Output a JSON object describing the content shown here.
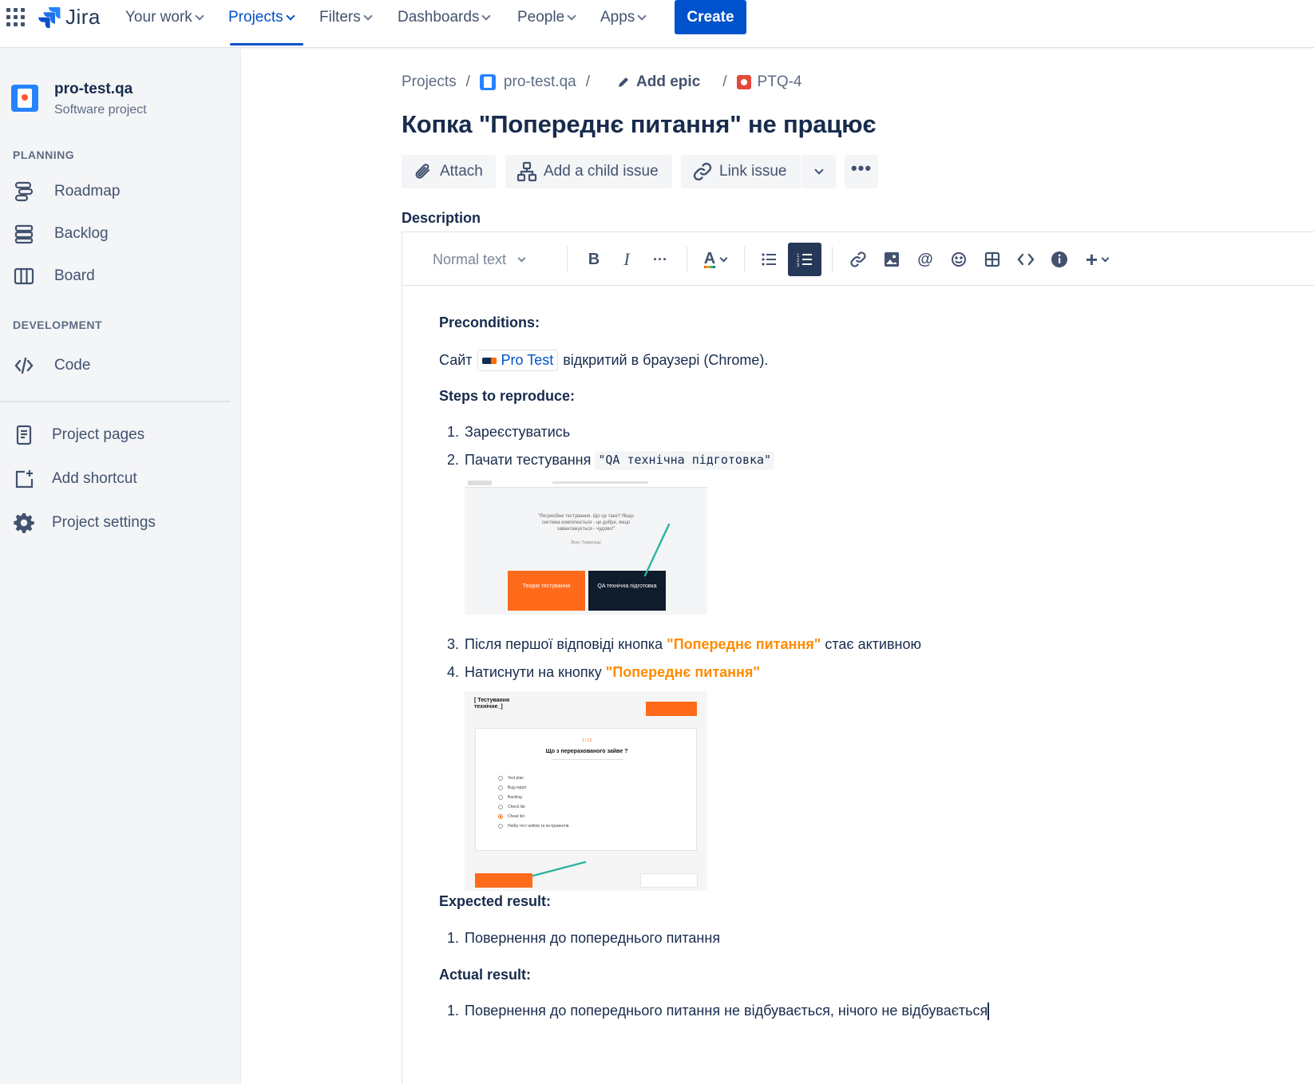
{
  "topnav": {
    "logo_text": "Jira",
    "items": [
      {
        "label": "Your work"
      },
      {
        "label": "Projects"
      },
      {
        "label": "Filters"
      },
      {
        "label": "Dashboards"
      },
      {
        "label": "People"
      },
      {
        "label": "Apps"
      }
    ],
    "create_label": "Create"
  },
  "sidebar": {
    "project_name": "pro-test.qa",
    "project_type": "Software project",
    "planning_heading": "PLANNING",
    "planning_items": [
      {
        "label": "Roadmap",
        "icon": "roadmap-icon"
      },
      {
        "label": "Backlog",
        "icon": "backlog-icon"
      },
      {
        "label": "Board",
        "icon": "board-icon"
      }
    ],
    "development_heading": "DEVELOPMENT",
    "development_items": [
      {
        "label": "Code",
        "icon": "code-icon"
      }
    ],
    "bottom_items": [
      {
        "label": "Project pages",
        "icon": "page-icon"
      },
      {
        "label": "Add shortcut",
        "icon": "add-shortcut-icon"
      },
      {
        "label": "Project settings",
        "icon": "gear-icon"
      }
    ]
  },
  "breadcrumb": {
    "projects": "Projects",
    "project": "pro-test.qa",
    "epic": "Add epic",
    "issue_key": "PTQ-4"
  },
  "issue": {
    "title": "Копка \"Попереднє питання\" не працює"
  },
  "actions": {
    "attach": "Attach",
    "add_child": "Add a child issue",
    "link_issue": "Link issue"
  },
  "description": {
    "label": "Description",
    "toolbar": {
      "text_style": "Normal text"
    },
    "preconditions_heading": "Preconditions:",
    "preconditions_prefix": "Сайт",
    "preconditions_link": "Pro Test",
    "preconditions_suffix": "відкритий в браузері (Chrome).",
    "steps_heading": "Steps to reproduce:",
    "step1": "Зареєстуватись",
    "step2_text": "Пачати тестування",
    "step2_code": "\"QA технічна підготовка\"",
    "step3_prefix": "Після першої відповіді кнопка",
    "step3_highlight": "\"Попереднє питання\"",
    "step3_suffix": "стає активною",
    "step4_prefix": "Натиснути на кнопку",
    "step4_highlight": "\"Попереднє питання\"",
    "expected_heading": "Expected result:",
    "expected1": "Повернення до попереднього питання",
    "actual_heading": "Actual result:",
    "actual1": "Повернення до попереднього питання не відбувається, нічого не відбувається",
    "shot1": {
      "quote": "\"Регресійне тестування. Що це таке? Якщо система компілюється - це добре, якщо завантажується - чудово!\"",
      "author": "Лінус Торвальдс",
      "btn_left": "Теорія тестування",
      "btn_right": "QA технічна підготовка"
    },
    "shot2": {
      "header_title": "[ Тестування технічне_]",
      "counter": "1 / 12",
      "question": "Що з перерахованого зайве ?",
      "options": [
        "Test plan",
        "Bug report",
        "Backlog",
        "Check list",
        "Cheat list",
        "Набір тест кейсів та інструментів"
      ]
    }
  },
  "colors": {
    "brand": "#0052cc",
    "accent_orange": "#ff8b00",
    "text": "#172b4d"
  }
}
